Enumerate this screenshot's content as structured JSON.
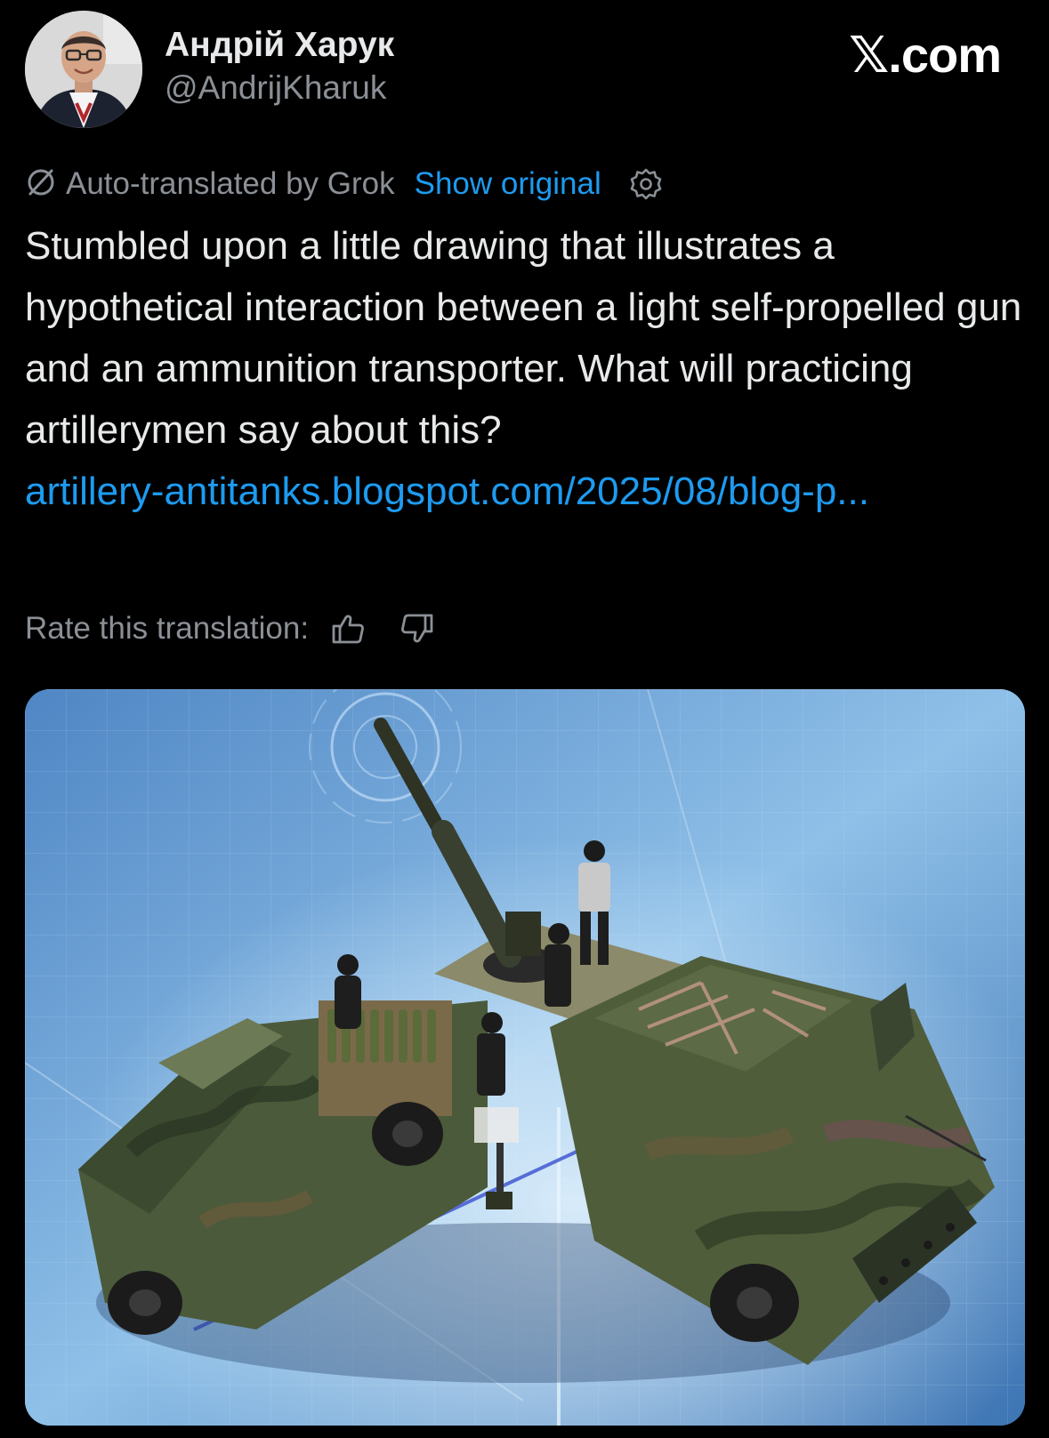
{
  "post": {
    "author_name": "Андрій Харук",
    "author_handle": "@AndrijKharuk",
    "brand": "𝕏.com",
    "translation": {
      "notice": "Auto-translated by Grok",
      "show_original": "Show original"
    },
    "text": "Stumbled upon a little drawing that illustrates a hypothetical interaction between a light self-propelled gun and an ammunition transporter. What will practicing artillerymen say about this?",
    "link": "artillery-antitanks.blogspot.com/2025/08/blog-p...",
    "rate_label": "Rate this translation:"
  },
  "icons": {
    "translate": "translate-slash-icon",
    "settings": "gear-icon",
    "thumbs_up": "thumbs-up-icon",
    "thumbs_down": "thumbs-down-icon"
  },
  "colors": {
    "background": "#000000",
    "text": "#e7e9ea",
    "muted": "#8b9096",
    "link": "#1d9bf0"
  }
}
